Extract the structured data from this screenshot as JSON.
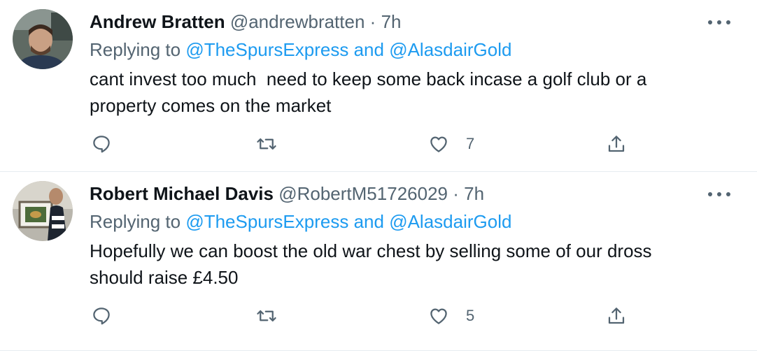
{
  "tweets": [
    {
      "name": "Andrew Bratten",
      "handle": "@andrewbratten",
      "dot": "·",
      "time": "7h",
      "replying_prefix": "Replying to ",
      "replying_user1": "@TheSpursExpress",
      "replying_and": " and ",
      "replying_user2": "@AlasdairGold",
      "text": "cant invest too much  need to keep some back incase a golf club or a\nproperty comes on the market",
      "likes": "7",
      "avatar_icon": "profile-photo-man-icon"
    },
    {
      "name": "Robert Michael Davis",
      "handle": "@RobertM51726029",
      "dot": "·",
      "time": "7h",
      "replying_prefix": "Replying to ",
      "replying_user1": "@TheSpursExpress",
      "replying_and": " and ",
      "replying_user2": "@AlasdairGold",
      "text": "Hopefully we can boost the old war chest by selling some of our dross\nshould raise £4.50",
      "likes": "5",
      "avatar_icon": "profile-photo-man-with-frame-icon"
    }
  ],
  "colors": {
    "link": "#1d9bf0",
    "secondary": "#536471",
    "primary": "#0f1419",
    "divider": "#e6ecf0"
  },
  "icons": {
    "more": "more-dots-icon",
    "reply": "reply-bubble-icon",
    "retweet": "retweet-icon",
    "like": "heart-icon",
    "share": "share-upload-icon"
  }
}
